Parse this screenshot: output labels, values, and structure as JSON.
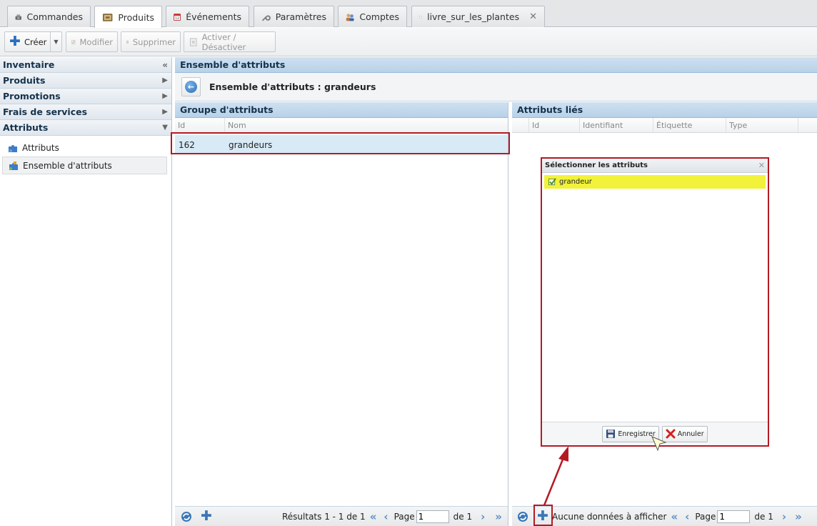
{
  "tabs": [
    {
      "label": "Commandes",
      "icon": "cash-register-icon"
    },
    {
      "label": "Produits",
      "icon": "products-icon",
      "active": true
    },
    {
      "label": "Événements",
      "icon": "calendar-icon"
    },
    {
      "label": "Paramètres",
      "icon": "wrench-icon"
    },
    {
      "label": "Comptes",
      "icon": "accounts-icon"
    },
    {
      "label": "livre_sur_les_plantes",
      "icon": "book-icon",
      "closable": true
    }
  ],
  "toolbar": {
    "create": "Créer",
    "modify": "Modifier",
    "delete": "Supprimer",
    "toggle": "Activer / Désactiver"
  },
  "nav": {
    "sections": [
      {
        "label": "Inventaire",
        "arrow": "«"
      },
      {
        "label": "Produits",
        "arrow": "▶"
      },
      {
        "label": "Promotions",
        "arrow": "▶"
      },
      {
        "label": "Frais de services",
        "arrow": "▶"
      },
      {
        "label": "Attributs",
        "arrow": "▼"
      }
    ],
    "sub_items": [
      {
        "label": "Attributs"
      },
      {
        "label": "Ensemble d'attributs",
        "selected": true
      }
    ]
  },
  "main": {
    "title": "Ensemble d'attributs",
    "subtitle": "Ensemble d'attributs : grandeurs"
  },
  "left_grid": {
    "title": "Groupe d'attributs",
    "columns": [
      "Id",
      "Nom"
    ],
    "rows": [
      {
        "id": "162",
        "nom": "grandeurs"
      }
    ],
    "pager": {
      "results": "Résultats 1 - 1 de 1",
      "page_label": "Page",
      "page_value": "1",
      "of_label": "de 1"
    }
  },
  "right_grid": {
    "title": "Attributs liés",
    "columns": [
      "Id",
      "Identifiant",
      "Étiquette",
      "Type"
    ],
    "pager": {
      "empty": "Aucune données à afficher",
      "page_label": "Page",
      "page_value": "1",
      "of_label": "de 1"
    }
  },
  "modal": {
    "title": "Sélectionner les attributs",
    "items": [
      {
        "label": "grandeur",
        "checked": true
      }
    ],
    "save": "Enregistrer",
    "cancel": "Annuler"
  },
  "colors": {
    "accent": "#2b6bb3",
    "highlight": "#f2f23a",
    "annotation": "#b31b24",
    "row_selected": "#d8eaf6"
  }
}
